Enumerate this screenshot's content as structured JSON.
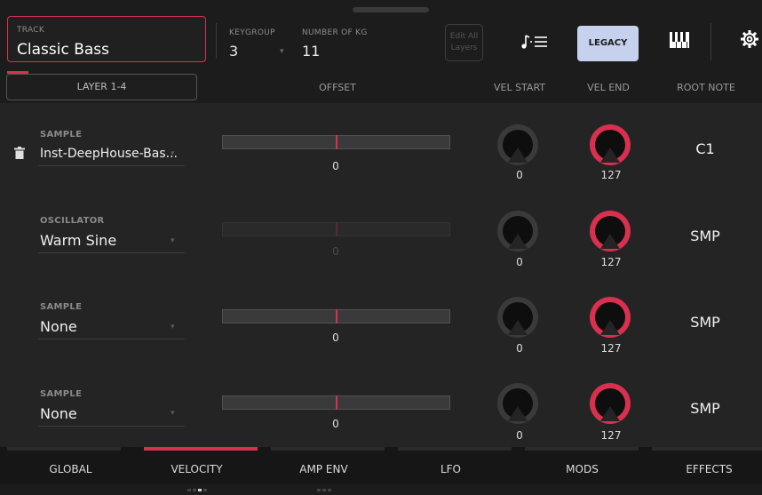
{
  "header": {
    "track_label": "TRACK",
    "track_name": "Classic Bass",
    "keygroup_label": "KEYGROUP",
    "keygroup_value": "3",
    "numkg_label": "NUMBER OF KG",
    "numkg_value": "11",
    "edit_all_line1": "Edit All",
    "edit_all_line2": "Layers",
    "legacy_label": "LEGACY"
  },
  "columns": {
    "layer_tab": "LAYER 1-4",
    "offset": "OFFSET",
    "vel_start": "VEL START",
    "vel_end": "VEL END",
    "root_note": "ROOT NOTE"
  },
  "rows": [
    {
      "type": "SAMPLE",
      "name": "Inst-DeepHouse-Bas...",
      "offset": "0",
      "vel_start": "0",
      "vel_end": "127",
      "root": "C1"
    },
    {
      "type": "OSCILLATOR",
      "name": "Warm Sine",
      "offset": "0",
      "vel_start": "0",
      "vel_end": "127",
      "root": "SMP"
    },
    {
      "type": "SAMPLE",
      "name": "None",
      "offset": "0",
      "vel_start": "0",
      "vel_end": "127",
      "root": "SMP"
    },
    {
      "type": "SAMPLE",
      "name": "None",
      "offset": "0",
      "vel_start": "0",
      "vel_end": "127",
      "root": "SMP"
    }
  ],
  "footer": {
    "tabs": [
      "GLOBAL",
      "VELOCITY",
      "AMP ENV",
      "LFO",
      "MODS",
      "EFFECTS"
    ],
    "active_tab": "VELOCITY"
  },
  "colors": {
    "accent": "#d8304e",
    "legacy_bg": "#c6d1ee",
    "background": "#1c1c1c",
    "row_bg": "#242424"
  }
}
